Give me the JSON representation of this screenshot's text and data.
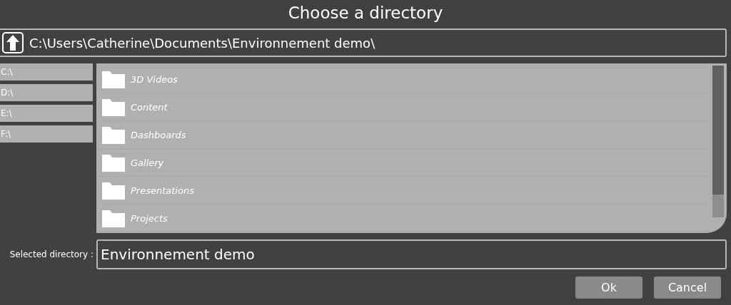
{
  "window": {
    "title": "Choose a directory"
  },
  "path_bar": {
    "value": "C:\\Users\\Catherine\\Documents\\Environnement demo\\"
  },
  "drives": [
    {
      "label": "C:\\"
    },
    {
      "label": "D:\\"
    },
    {
      "label": "E:\\"
    },
    {
      "label": "F:\\"
    }
  ],
  "folders": [
    {
      "name": "3D Videos"
    },
    {
      "name": "Content"
    },
    {
      "name": "Dashboards"
    },
    {
      "name": "Gallery"
    },
    {
      "name": "Presentations"
    },
    {
      "name": "Projects"
    }
  ],
  "selected_directory": {
    "label": "Selected directory :",
    "value": "Environnement demo"
  },
  "buttons": [
    {
      "label": "Ok"
    },
    {
      "label": "Cancel"
    }
  ]
}
